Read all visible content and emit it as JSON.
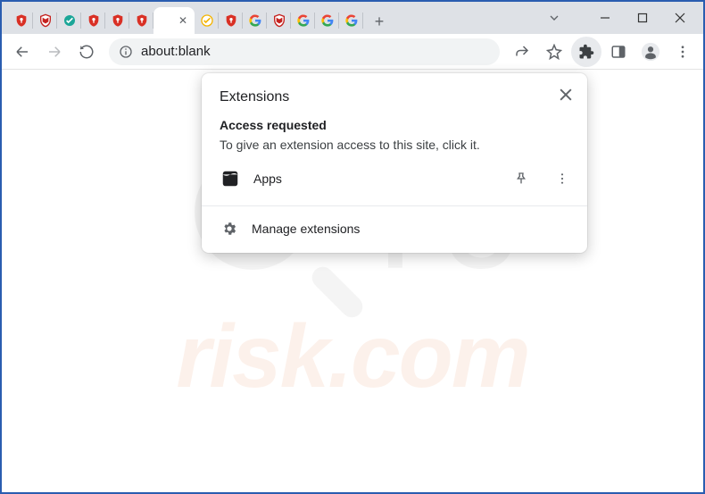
{
  "window": {
    "chevron_label": "Tab search"
  },
  "tabs": [
    {
      "icon": "shield-red"
    },
    {
      "icon": "mcafee"
    },
    {
      "icon": "teal-check"
    },
    {
      "icon": "shield-red"
    },
    {
      "icon": "shield-red"
    },
    {
      "icon": "shield-red"
    },
    {
      "icon": "active"
    },
    {
      "icon": "yellow-check"
    },
    {
      "icon": "shield-red"
    },
    {
      "icon": "google"
    },
    {
      "icon": "mcafee"
    },
    {
      "icon": "google"
    },
    {
      "icon": "google"
    },
    {
      "icon": "google"
    }
  ],
  "active_tab_index": 6,
  "omnibox": {
    "url": "about:blank"
  },
  "popup": {
    "title": "Extensions",
    "access_heading": "Access requested",
    "access_text": "To give an extension access to this site, click it.",
    "items": [
      {
        "name": "Apps",
        "icon": "apps-icon"
      }
    ],
    "manage_label": "Manage extensions"
  },
  "watermark": {
    "pc": "PC",
    "risk": "risk.com"
  }
}
